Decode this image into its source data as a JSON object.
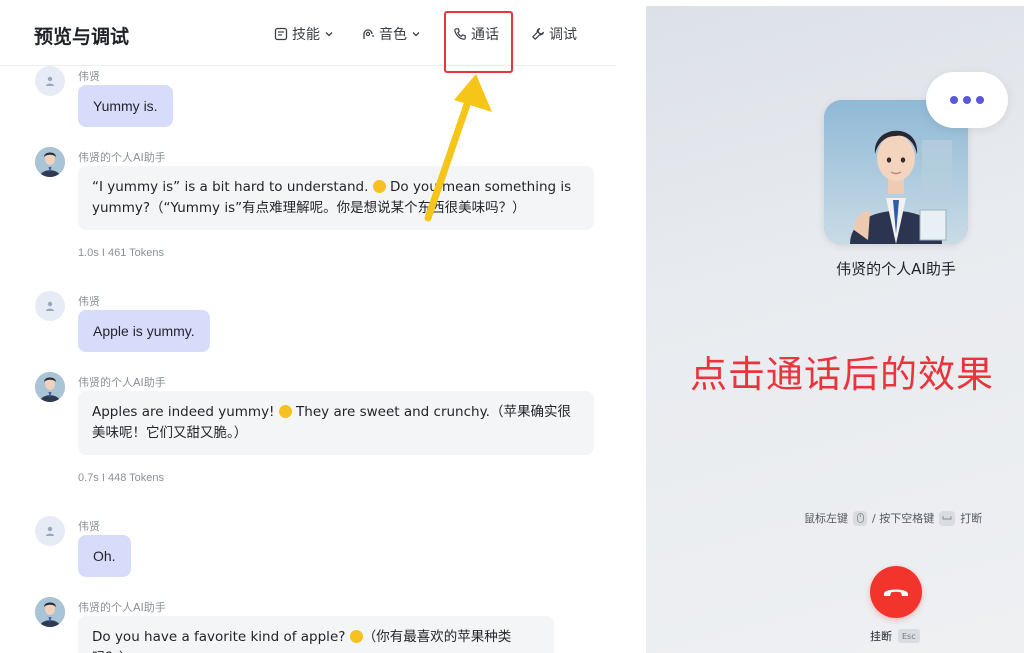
{
  "header": {
    "title": "预览与调试",
    "tabs": {
      "skills": "技能",
      "voice": "音色",
      "call": "通话",
      "debug": "调试"
    }
  },
  "messages": [
    {
      "role": "user",
      "sender": "伟贤",
      "text": "Yummy is."
    },
    {
      "role": "bot",
      "sender": "伟贤的个人AI助手",
      "text_before": "“I yummy is” is a bit hard to understand. ",
      "text_after": " Do you mean something is yummy?（“Yummy is”有点难理解呢。你是想说某个东西很美味吗？）",
      "meta": "1.0s  I  461 Tokens"
    },
    {
      "role": "user",
      "sender": "伟贤",
      "text": "Apple is yummy."
    },
    {
      "role": "bot",
      "sender": "伟贤的个人AI助手",
      "text_before": "Apples are indeed yummy! ",
      "text_after": " They are sweet and crunchy.（苹果确实很美味呢！它们又甜又脆。）",
      "meta": "0.7s  I  448 Tokens"
    },
    {
      "role": "user",
      "sender": "伟贤",
      "text": "Oh."
    },
    {
      "role": "bot",
      "sender": "伟贤的个人AI助手",
      "text_before": "Do you have a favorite kind of apple? ",
      "text_after": "（你有最喜欢的苹果种类吗？）"
    }
  ],
  "call_panel": {
    "bot_name": "伟贤的个人AI助手",
    "annotation": "点击通话后的效果",
    "hint_left": "鼠标左键",
    "hint_sep": "/ 按下空格键",
    "hint_right": "打断",
    "hangup_label": "挂断",
    "esc_key": "Esc"
  },
  "colors": {
    "accent": "#5a58d6",
    "user_bubble": "#d8dcfb",
    "highlight": "#e8343a",
    "arrow": "#f5c518",
    "hangup": "#f2342c"
  }
}
